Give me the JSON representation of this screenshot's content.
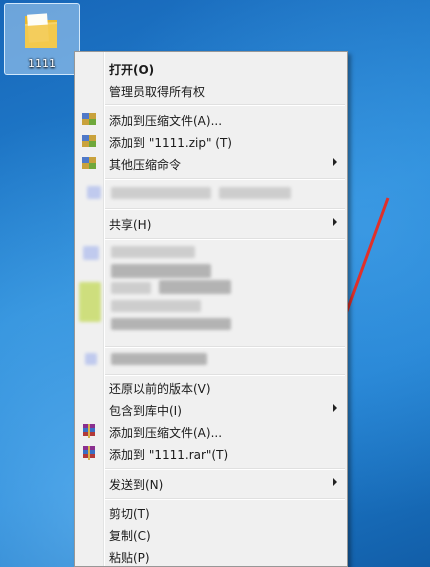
{
  "desktop": {
    "folder_label": "1111"
  },
  "context_menu": {
    "items": [
      {
        "id": "open",
        "label": "打开(O)"
      },
      {
        "id": "take-ownership",
        "label": "管理员取得所有权"
      },
      {
        "id": "add-archive-1",
        "label": "添加到压缩文件(A)..."
      },
      {
        "id": "add-zip",
        "label": "添加到 \"1111.zip\" (T)"
      },
      {
        "id": "other-compress",
        "label": "其他压缩命令"
      },
      {
        "id": "share",
        "label": "共享(H)"
      },
      {
        "id": "restore-prev",
        "label": "还原以前的版本(V)"
      },
      {
        "id": "include-library",
        "label": "包含到库中(I)"
      },
      {
        "id": "add-archive-2",
        "label": "添加到压缩文件(A)..."
      },
      {
        "id": "add-rar",
        "label": "添加到 \"1111.rar\"(T)"
      },
      {
        "id": "send-to",
        "label": "发送到(N)"
      },
      {
        "id": "cut",
        "label": "剪切(T)"
      },
      {
        "id": "copy",
        "label": "复制(C)"
      },
      {
        "id": "paste",
        "label": "粘贴(P)"
      }
    ]
  },
  "colors": {
    "desktop_blue": "#1f7fd0",
    "menu_bg": "#f0f0f0",
    "annotation_arrow": "#e0302a"
  }
}
